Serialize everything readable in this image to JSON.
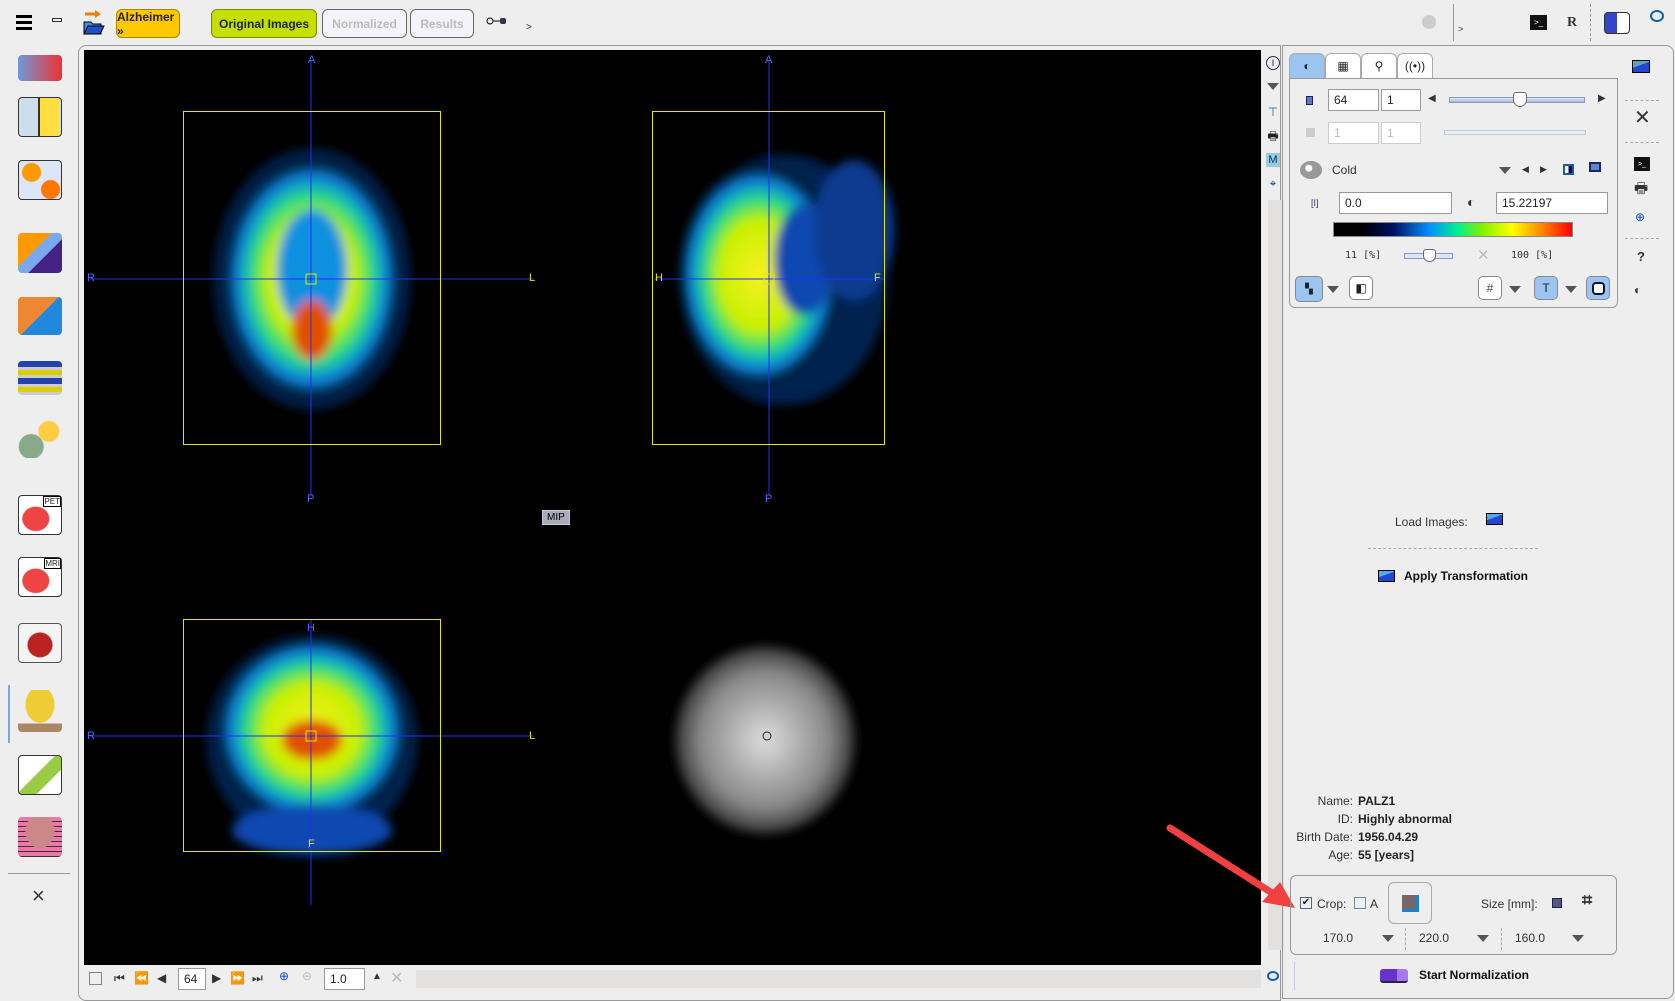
{
  "toolbar": {
    "menu_icon": "hamburger-menu-icon",
    "workflow": "Alzheimer »",
    "tabs": [
      {
        "label": "Original Images",
        "state": "active"
      },
      {
        "label": "Normalized",
        "state": "disabled"
      },
      {
        "label": "Results",
        "state": "disabled"
      }
    ],
    "more": ">",
    "colors": {
      "workflow": "#ffc800",
      "active_tab": "#c4e000"
    }
  },
  "sidebar": {
    "items": [
      "kinetic-modeling-icon",
      "model-icon",
      "fusion-icon",
      "segmentation-icon",
      "data-layout-icon",
      "3d-render-icon",
      "pet-cardiac-icon",
      "mri-cardiac-icon",
      "heart-icon",
      "brain-tool-icon",
      "slice-tool-icon",
      "brain-stack-icon"
    ],
    "pet_label": "PET",
    "mri_label": "MRI",
    "close": "×"
  },
  "viewer": {
    "axial": {
      "top": "A",
      "bottom": "P",
      "left": "R",
      "right": "L"
    },
    "sagittal": {
      "top": "A",
      "bottom": "P",
      "left": "H",
      "right": "F"
    },
    "coronal": {
      "top": "H",
      "bottom": "F",
      "left": "R",
      "right": "L"
    },
    "mip_label": "MIP"
  },
  "bottom_bar": {
    "slice": "64",
    "zoom": "1.0"
  },
  "control_panel": {
    "slice": "64",
    "frame": "1",
    "slice2": "1",
    "frame2": "1",
    "slice_slider_fraction": 0.5,
    "colortable": "Cold",
    "min_value": "0.0",
    "max_value": "15.22197",
    "lower_percent": "11",
    "upper_percent": "100",
    "percent_unit": "[%]"
  },
  "load_images_label": "Load Images:",
  "apply_transformation_label": "Apply Transformation",
  "patient": {
    "name_label": "Name:",
    "name": "PALZ1",
    "id_label": "ID:",
    "id": "Highly abnormal",
    "birth_label": "Birth Date:",
    "birth": "1956.04.29",
    "age_label": "Age:",
    "age": "55 [years]"
  },
  "crop": {
    "label": "Crop:",
    "checked": true,
    "auto_label": "A",
    "auto_checked": false,
    "size_label": "Size [mm]:",
    "sizes": [
      "170.0",
      "220.0",
      "160.0"
    ]
  },
  "start_normalization_label": "Start Normalization",
  "right_column": {
    "r_label": "R",
    "help": "?"
  }
}
